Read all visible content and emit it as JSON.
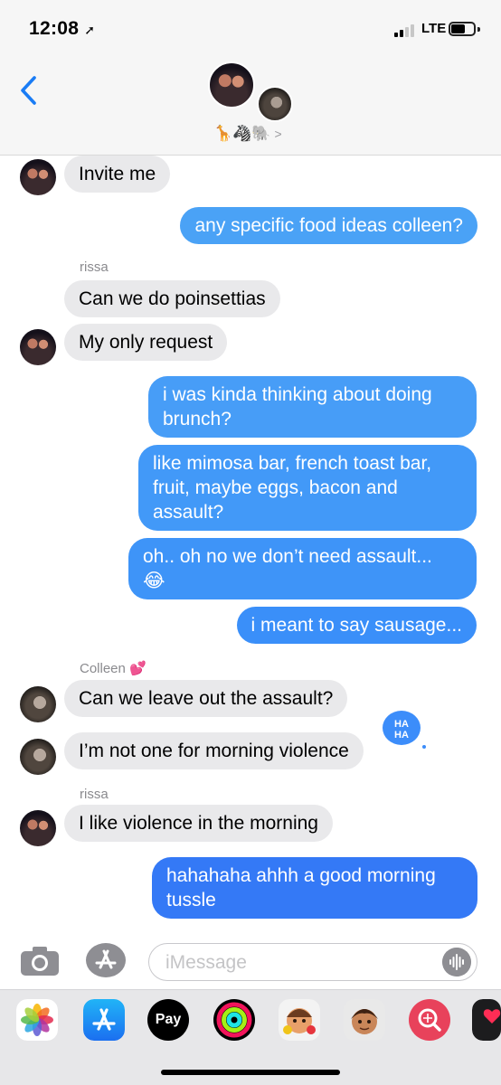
{
  "status_bar": {
    "time": "12:08",
    "network": "LTE"
  },
  "header": {
    "group_emoji": "🦒🦓🐘",
    "chevron": ">"
  },
  "messages": [
    {
      "from": "rissa",
      "direction": "in",
      "text": "Invite me"
    },
    {
      "from": "me",
      "direction": "out",
      "text": "any specific food ideas colleen?"
    },
    {
      "sender_label": "rissa"
    },
    {
      "from": "rissa",
      "direction": "in",
      "text": "Can we do poinsettias"
    },
    {
      "from": "rissa",
      "direction": "in",
      "text": "My only request"
    },
    {
      "from": "me",
      "direction": "out",
      "text": "i was kinda thinking about doing\nbrunch?"
    },
    {
      "from": "me",
      "direction": "out",
      "text": "like mimosa bar, french toast bar,\nfruit, maybe eggs, bacon and\nassault?"
    },
    {
      "from": "me",
      "direction": "out",
      "text": "oh.. oh no we don’t need assault...\n😂"
    },
    {
      "from": "me",
      "direction": "out",
      "text": "i meant to say sausage..."
    },
    {
      "sender_label": "Colleen 💕"
    },
    {
      "from": "Colleen",
      "direction": "in",
      "text": "Can we leave out the assault?"
    },
    {
      "from": "Colleen",
      "direction": "in",
      "text": "I’m not one for morning violence",
      "tapback": "HA\nHA"
    },
    {
      "sender_label": "rissa"
    },
    {
      "from": "rissa",
      "direction": "in",
      "text": "I like violence in the morning"
    },
    {
      "from": "me",
      "direction": "out",
      "text": "hahahaha ahhh a good morning\ntussle"
    }
  ],
  "compose": {
    "placeholder": "iMessage"
  },
  "app_drawer": {
    "apple_pay_label": "Pay",
    "apps": [
      "photos-app",
      "app-store-app",
      "apple-pay-app",
      "activity-app",
      "memoji-stickers-app",
      "animoji-app",
      "search-images-app",
      "digital-touch-app"
    ]
  },
  "colors": {
    "incoming_bubble": "#e9e9eb",
    "outgoing_bubble": "#3c8dfa",
    "accent": "#1a7cf5",
    "secondary_text": "#8a8a8e"
  }
}
